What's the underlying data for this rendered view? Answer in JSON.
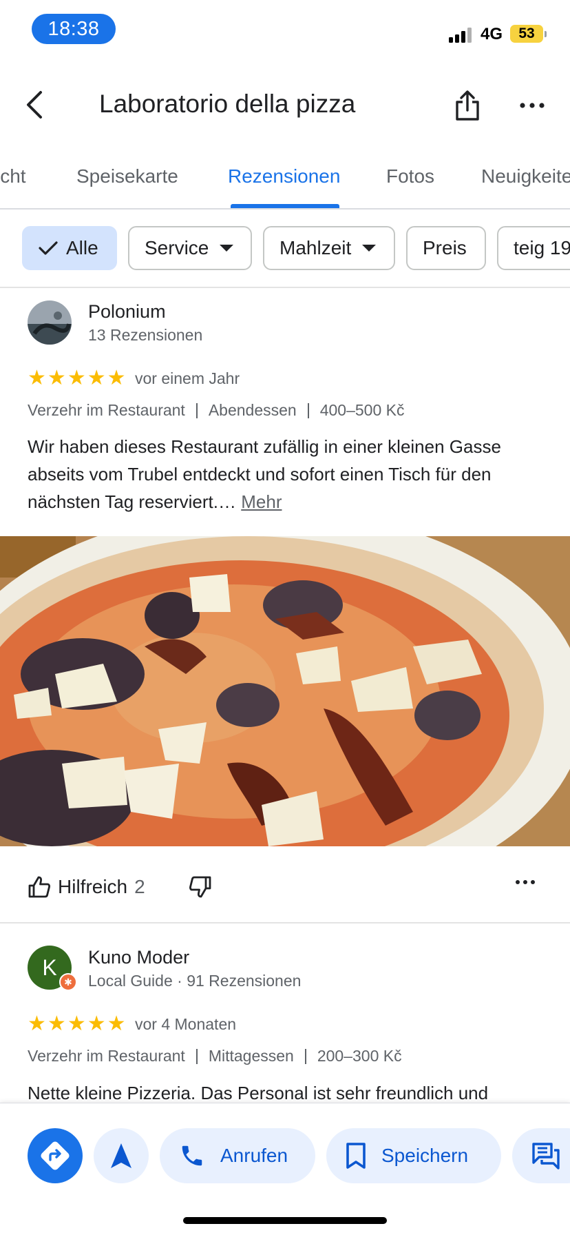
{
  "status_bar": {
    "time": "18:38",
    "network": "4G",
    "battery": "53"
  },
  "header": {
    "title": "Laboratorio della pizza"
  },
  "tabs": [
    {
      "label": "icht"
    },
    {
      "label": "Speisekarte"
    },
    {
      "label": "Rezensionen"
    },
    {
      "label": "Fotos"
    },
    {
      "label": "Neuigkeiten"
    }
  ],
  "filters": [
    {
      "label": "Alle"
    },
    {
      "label": "Service"
    },
    {
      "label": "Mahlzeit"
    },
    {
      "label": "Preis"
    },
    {
      "label": "teig 19"
    }
  ],
  "reviews": [
    {
      "name": "Polonium",
      "meta": "13 Rezensionen",
      "rating": 5,
      "date": "vor einem Jahr",
      "tags": [
        "Verzehr im Restaurant",
        "Abendessen",
        "400–500 Kč"
      ],
      "text": "Wir haben dieses Restaurant zufällig in einer kleinen Gasse abseits vom Trubel entdeckt und sofort einen Tisch für den nächsten Tag reserviert.…",
      "more": "Mehr",
      "helpful_label": "Hilfreich",
      "helpful_count": "2"
    },
    {
      "name": "Kuno Moder",
      "initial": "K",
      "meta": "Local Guide · 91 Rezensionen",
      "rating": 5,
      "date": "vor 4 Monaten",
      "tags": [
        "Verzehr im Restaurant",
        "Mittagessen",
        "200–300 Kč"
      ],
      "text": "Nette kleine Pizzeria. Das Personal ist sehr freundlich und"
    }
  ],
  "actions": {
    "call": "Anrufen",
    "save": "Speichern"
  },
  "colors": {
    "accent": "#1a73e8",
    "star": "#fbbc04",
    "chip_selected": "#d3e3fd",
    "action_bg": "#e8f0fe"
  }
}
